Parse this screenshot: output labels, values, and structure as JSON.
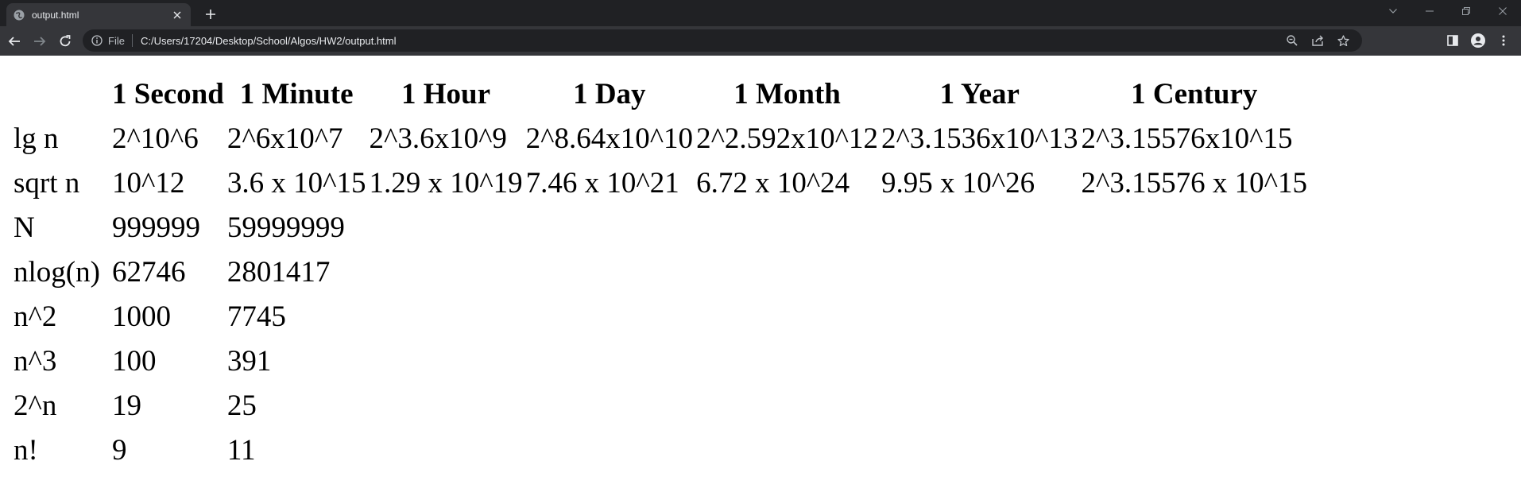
{
  "browser": {
    "tab_title": "output.html",
    "address_scheme_label": "File",
    "address_url": "C:/Users/17204/Desktop/School/Algos/HW2/output.html"
  },
  "table": {
    "headers": [
      "",
      "1 Second",
      "1 Minute",
      "1 Hour",
      "1 Day",
      "1 Month",
      "1 Year",
      "1 Century"
    ],
    "rows": [
      {
        "label": "lg n",
        "cells": [
          "2^10^6",
          "2^6x10^7",
          "2^3.6x10^9",
          "2^8.64x10^10",
          "2^2.592x10^12",
          "2^3.1536x10^13",
          "2^3.15576x10^15"
        ]
      },
      {
        "label": "sqrt n",
        "cells": [
          "10^12",
          "3.6 x 10^15",
          "1.29 x 10^19",
          "7.46 x 10^21",
          "6.72 x 10^24",
          "9.95 x 10^26",
          "2^3.15576 x 10^15"
        ]
      },
      {
        "label": "N",
        "cells": [
          "999999",
          "59999999",
          "",
          "",
          "",
          "",
          ""
        ]
      },
      {
        "label": "nlog(n)",
        "cells": [
          "62746",
          "2801417",
          "",
          "",
          "",
          "",
          ""
        ]
      },
      {
        "label": "n^2",
        "cells": [
          "1000",
          "7745",
          "",
          "",
          "",
          "",
          ""
        ]
      },
      {
        "label": "n^3",
        "cells": [
          "100",
          "391",
          "",
          "",
          "",
          "",
          ""
        ]
      },
      {
        "label": "2^n",
        "cells": [
          "19",
          "25",
          "",
          "",
          "",
          "",
          ""
        ]
      },
      {
        "label": "n!",
        "cells": [
          "9",
          "11",
          "",
          "",
          "",
          "",
          ""
        ]
      }
    ]
  }
}
